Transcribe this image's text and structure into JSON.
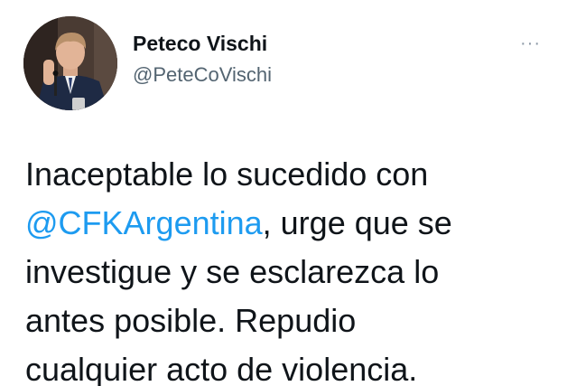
{
  "author": {
    "display_name": "Peteco Vischi",
    "handle": "@PeteCoVischi"
  },
  "icons": {
    "more": "more-horizontal-icon",
    "more_glyph": "···"
  },
  "tweet": {
    "text_part1": "Inaceptable lo sucedido con",
    "mention": "@CFKArgentina",
    "text_part2": ", urge que se",
    "line3": "investigue y se esclarezca lo",
    "line4": "antes posible. Repudio",
    "line5": "cualquier acto de violencia."
  },
  "colors": {
    "mention": "#1d9bf0",
    "handle": "#536471",
    "text": "#0f1419"
  }
}
